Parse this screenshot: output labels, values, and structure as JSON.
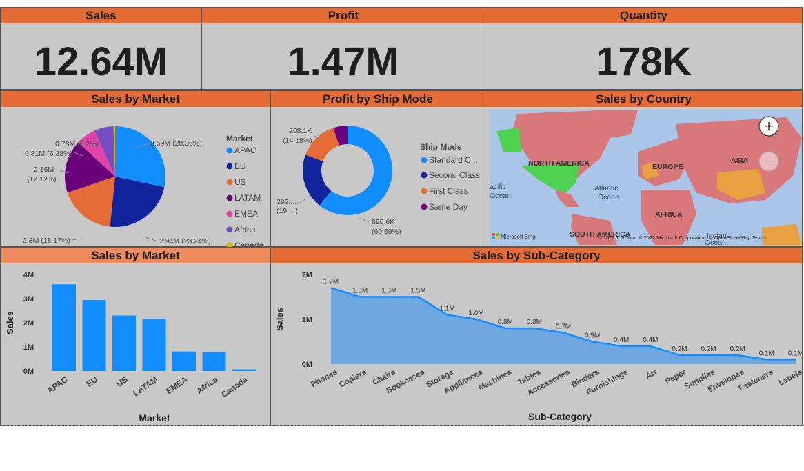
{
  "kpis": {
    "sales": {
      "title": "Sales",
      "value": "12.64M"
    },
    "profit": {
      "title": "Profit",
      "value": "1.47M"
    },
    "quantity": {
      "title": "Quantity",
      "value": "178K"
    }
  },
  "pie_market": {
    "title": "Sales by Market",
    "legend_title": "Market",
    "labels": [
      "3.59M (28.36%)",
      "2.94M (23.24%)",
      "2.3M (18.17%)",
      "2.16M",
      "(17.12%)",
      "0.81M (6.38%)",
      "0.78M (6.2%)"
    ]
  },
  "donut_ship": {
    "title": "Profit by Ship Mode",
    "legend_title": "Ship Mode",
    "legend_items": [
      "Standard C...",
      "Second Class",
      "First Class",
      "Same Day"
    ],
    "labels": [
      "208.1K",
      "(14.18%)",
      "292....",
      "(19....)",
      "890.6K",
      "(60.69%)"
    ]
  },
  "map": {
    "title": "Sales by Country",
    "regions": [
      "NORTH AMERICA",
      "EUROPE",
      "ASIA",
      "AFRICA",
      "SOUTH AMERICA",
      "Atlantic",
      "Ocean",
      "acific",
      "Ocean",
      "Indian",
      "Ocean"
    ],
    "attribution": "© 2022 TomTom, © 2022 Microsoft Corporation, © OpenStreetMap  Terms",
    "brand": "Microsoft Bing",
    "zoom_in": "+",
    "zoom_out": "−"
  },
  "bar_market": {
    "title": "Sales by Market",
    "xlabel": "Market",
    "ylabel": "Sales",
    "yticks": [
      "4M",
      "3M",
      "2M",
      "1M",
      "0M"
    ]
  },
  "area_sub": {
    "title": "Sales by Sub-Category",
    "xlabel": "Sub-Category",
    "ylabel": "Sales",
    "yticks": [
      "2M",
      "1M",
      "0M"
    ]
  },
  "colors": {
    "header": "#e46c34",
    "tile_bg": "#c8c8c8",
    "bar_blue": "#118dff"
  },
  "chart_data": [
    {
      "type": "pie",
      "title": "Sales by Market",
      "legend_title": "Market",
      "categories": [
        "APAC",
        "EU",
        "US",
        "LATAM",
        "EMEA",
        "Africa",
        "Canada"
      ],
      "values": [
        3.59,
        2.94,
        2.3,
        2.16,
        0.81,
        0.78,
        0.07
      ],
      "percent": [
        28.36,
        23.24,
        18.17,
        17.12,
        6.38,
        6.2,
        0.52
      ],
      "colors": [
        "#118dff",
        "#12239e",
        "#e66c37",
        "#6b007b",
        "#e044a7",
        "#744ec2",
        "#d9b300"
      ],
      "legend": "right"
    },
    {
      "type": "pie",
      "title": "Profit by Ship Mode",
      "legend_title": "Ship Mode",
      "categories": [
        "Standard Class",
        "Second Class",
        "First Class",
        "Same Day"
      ],
      "values": [
        890.6,
        292.0,
        208.1,
        76.0
      ],
      "percent": [
        60.69,
        19.9,
        14.18,
        5.2
      ],
      "colors": [
        "#118dff",
        "#12239e",
        "#e66c37",
        "#6b007b"
      ],
      "donut": true,
      "legend": "right"
    },
    {
      "type": "bar",
      "title": "Sales by Market",
      "categories": [
        "APAC",
        "EU",
        "US",
        "LATAM",
        "EMEA",
        "Africa",
        "Canada"
      ],
      "values": [
        3.59,
        2.94,
        2.3,
        2.16,
        0.81,
        0.78,
        0.07
      ],
      "xlabel": "Market",
      "ylabel": "Sales",
      "ylim": [
        0,
        4
      ],
      "grid": false
    },
    {
      "type": "area",
      "title": "Sales by Sub-Category",
      "categories": [
        "Phones",
        "Copiers",
        "Chairs",
        "Bookcases",
        "Storage",
        "Appliances",
        "Machines",
        "Tables",
        "Accessories",
        "Binders",
        "Furnishings",
        "Art",
        "Paper",
        "Supplies",
        "Envelopes",
        "Fasteners",
        "Labels"
      ],
      "values": [
        1.7,
        1.5,
        1.5,
        1.5,
        1.1,
        1.0,
        0.8,
        0.8,
        0.7,
        0.5,
        0.4,
        0.4,
        0.2,
        0.2,
        0.2,
        0.1,
        0.1
      ],
      "data_labels": [
        "1.7M",
        "1.5M",
        "1.5M",
        "1.5M",
        "1.1M",
        "1.0M",
        "0.8M",
        "0.8M",
        "0.7M",
        "0.5M",
        "0.4M",
        "0.4M",
        "0.2M",
        "0.2M",
        "0.2M",
        "0.1M",
        "0.1M"
      ],
      "xlabel": "Sub-Category",
      "ylabel": "Sales",
      "ylim": [
        0,
        2
      ],
      "grid": false
    }
  ]
}
